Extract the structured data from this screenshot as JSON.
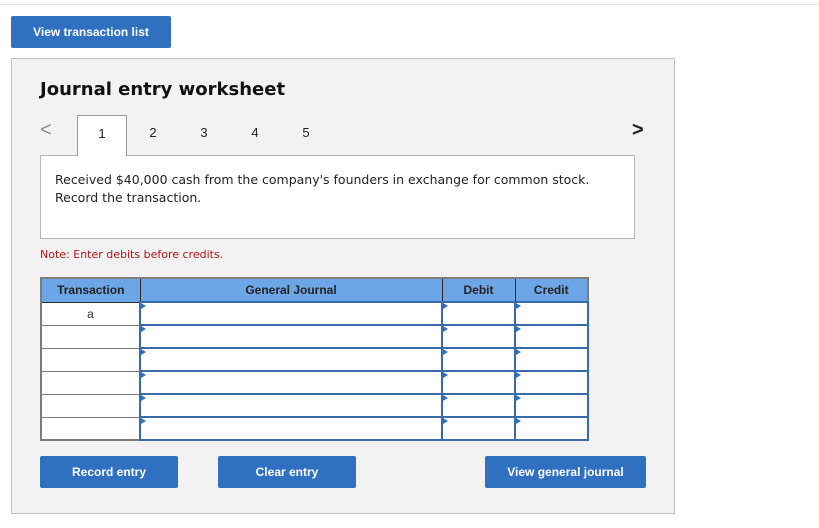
{
  "header": {
    "view_transaction_list_label": "View transaction list"
  },
  "worksheet": {
    "title": "Journal entry worksheet",
    "nav": {
      "prev_icon": "chevron-left-icon",
      "next_icon": "chevron-right-icon",
      "prev_glyph": "<",
      "next_glyph": ">"
    },
    "tabs": [
      {
        "label": "1",
        "active": true
      },
      {
        "label": "2",
        "active": false
      },
      {
        "label": "3",
        "active": false
      },
      {
        "label": "4",
        "active": false
      },
      {
        "label": "5",
        "active": false
      }
    ],
    "description": "Received $40,000 cash from the company's founders in exchange for common stock. Record the transaction.",
    "note": "Note: Enter debits before credits.",
    "table": {
      "headers": {
        "transaction": "Transaction",
        "general_journal": "General Journal",
        "debit": "Debit",
        "credit": "Credit"
      },
      "rows": [
        {
          "transaction": "a",
          "account": "",
          "debit": "",
          "credit": ""
        },
        {
          "transaction": "",
          "account": "",
          "debit": "",
          "credit": ""
        },
        {
          "transaction": "",
          "account": "",
          "debit": "",
          "credit": ""
        },
        {
          "transaction": "",
          "account": "",
          "debit": "",
          "credit": ""
        },
        {
          "transaction": "",
          "account": "",
          "debit": "",
          "credit": ""
        },
        {
          "transaction": "",
          "account": "",
          "debit": "",
          "credit": ""
        }
      ]
    },
    "buttons": {
      "record_entry": "Record entry",
      "clear_entry": "Clear entry",
      "view_general_journal": "View general journal"
    }
  },
  "colors": {
    "button_blue": "#2f70c1",
    "header_blue": "#6da6e6",
    "note_red": "#b0141a",
    "input_border": "#3b6aa8"
  }
}
